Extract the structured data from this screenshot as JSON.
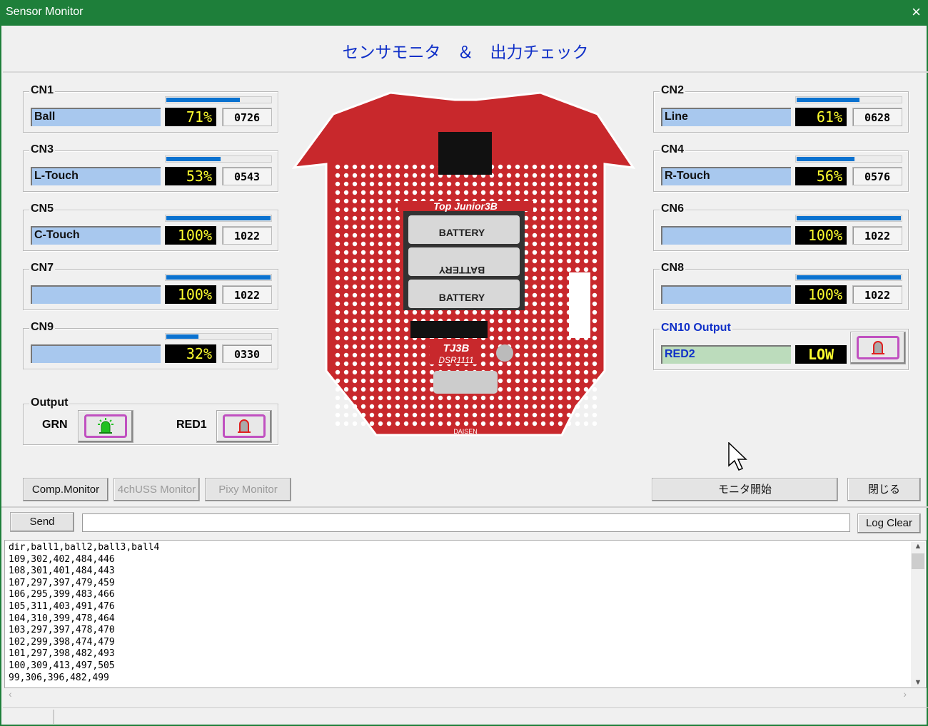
{
  "window": {
    "title": "Sensor Monitor",
    "close_icon": "×"
  },
  "header": {
    "title": "センサモニタ　＆　出力チェック"
  },
  "channels_left": [
    {
      "id": "CN1",
      "name": "Ball",
      "percent_text": "71%",
      "percent": 71,
      "value": "0726"
    },
    {
      "id": "CN3",
      "name": "L-Touch",
      "percent_text": "53%",
      "percent": 53,
      "value": "0543"
    },
    {
      "id": "CN5",
      "name": "C-Touch",
      "percent_text": "100%",
      "percent": 100,
      "value": "1022"
    },
    {
      "id": "CN7",
      "name": "",
      "percent_text": "100%",
      "percent": 100,
      "value": "1022"
    },
    {
      "id": "CN9",
      "name": "",
      "percent_text": "32%",
      "percent": 32,
      "value": "0330"
    }
  ],
  "channels_right": [
    {
      "id": "CN2",
      "name": "Line",
      "percent_text": "61%",
      "percent": 61,
      "value": "0628"
    },
    {
      "id": "CN4",
      "name": "R-Touch",
      "percent_text": "56%",
      "percent": 56,
      "value": "0576"
    },
    {
      "id": "CN6",
      "name": "",
      "percent_text": "100%",
      "percent": 100,
      "value": "1022"
    },
    {
      "id": "CN8",
      "name": "",
      "percent_text": "100%",
      "percent": 100,
      "value": "1022"
    }
  ],
  "cn10": {
    "label": "CN10 Output",
    "name": "RED2",
    "state": "LOW"
  },
  "output": {
    "label": "Output",
    "grn_label": "GRN",
    "red1_label": "RED1"
  },
  "board": {
    "title": "Top Junior3B",
    "battery": [
      "BATTERY",
      "BATTERY",
      "BATTERY"
    ],
    "logo": "TJ3B",
    "model": "DSR1111",
    "maker": "DAISEN"
  },
  "buttons": {
    "comp_monitor": "Comp.Monitor",
    "uss_monitor": "4chUSS Monitor",
    "pixy_monitor": "Pixy Monitor",
    "start_monitor": "モニタ開始",
    "close": "閉じる",
    "send": "Send",
    "log_clear": "Log Clear"
  },
  "send_input": {
    "value": ""
  },
  "log": {
    "lines": [
      "dir,ball1,ball2,ball3,ball4",
      "109,302,402,484,446",
      "108,301,401,484,443",
      "107,297,397,479,459",
      "106,295,399,483,466",
      "105,311,403,491,476",
      "104,310,399,478,464",
      "103,297,397,478,470",
      "102,299,398,474,479",
      "101,297,398,482,493",
      "100,309,413,497,505",
      "99,306,396,482,499"
    ]
  },
  "colors": {
    "titlebar": "#1e7f3a",
    "title_text": "#1030c8",
    "bar": "#0a72d0",
    "percent_text": "#ffff30",
    "board": "#c8282c"
  }
}
